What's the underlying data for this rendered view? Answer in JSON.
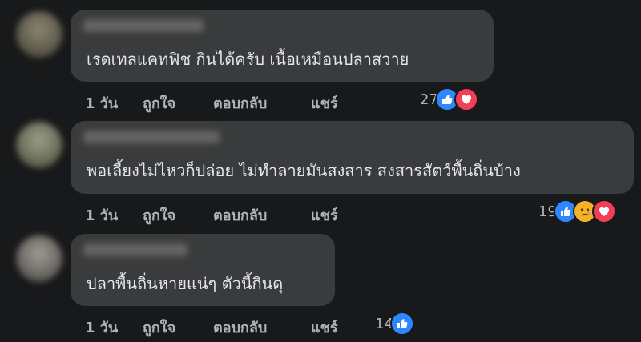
{
  "colors": {
    "background": "#18191a",
    "bubble": "#3a3b3c",
    "text": "#e4e6eb",
    "muted": "#b0b3b8",
    "like_blue": "#2d88ff",
    "love_red": "#f33e58",
    "sad_yellow": "#f7b125"
  },
  "comments": [
    {
      "text": "เรดเทลแคทฟิช กินได้ครับ เนื้อเหมือนปลาสวาย",
      "time": "1 วัน",
      "like": "ถูกใจ",
      "reply": "ตอบกลับ",
      "share": "แชร์",
      "reaction_count": "27",
      "reactions": [
        "like-icon",
        "love-icon"
      ]
    },
    {
      "text": "พอเลี้ยงไม่ไหวก็ปล่อย ไม่ทำลายมันสงสาร สงสารสัตว์พื้นถิ่นบ้าง",
      "time": "1 วัน",
      "like": "ถูกใจ",
      "reply": "ตอบกลับ",
      "share": "แชร์",
      "reaction_count": "19",
      "reactions": [
        "like-icon",
        "sad-icon",
        "love-icon"
      ]
    },
    {
      "text": "ปลาพื้นถิ่นหายแน่ๆ ตัวนี้กินดุ",
      "time": "1 วัน",
      "like": "ถูกใจ",
      "reply": "ตอบกลับ",
      "share": "แชร์",
      "reaction_count": "14",
      "reactions": [
        "like-icon"
      ]
    }
  ]
}
